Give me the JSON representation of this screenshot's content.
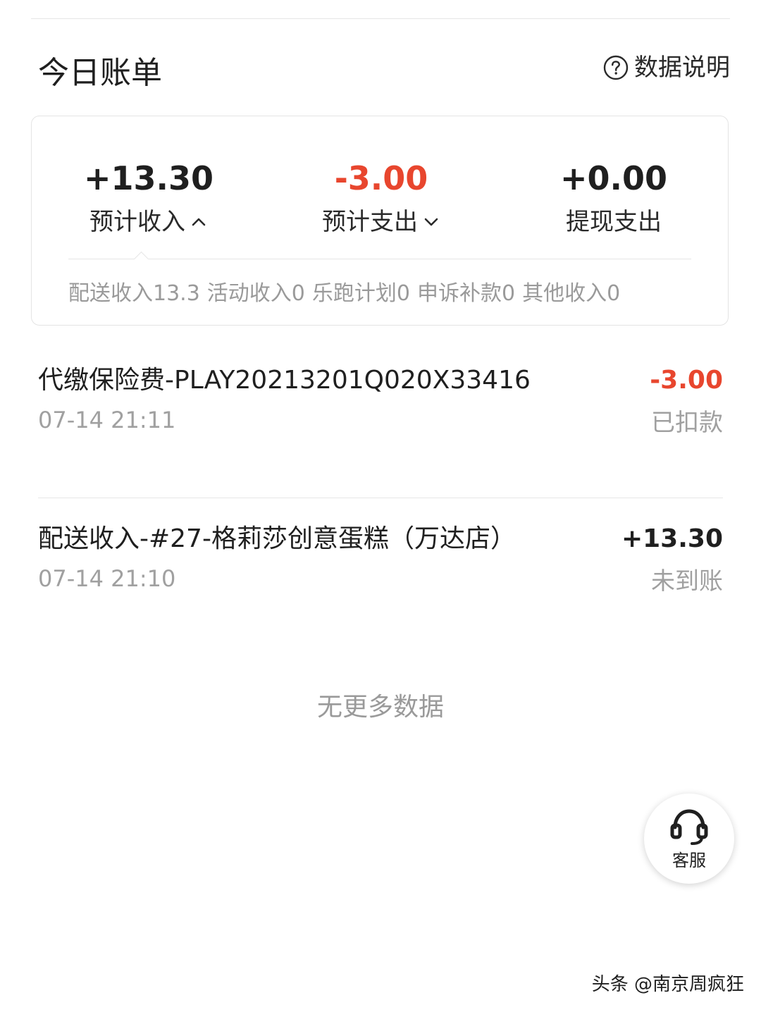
{
  "header": {
    "title": "今日账单",
    "help_label": "数据说明",
    "help_icon": "question-circle-icon"
  },
  "summary": {
    "income": {
      "value": "+13.30",
      "label": "预计收入",
      "chevron": "chevron-up-icon"
    },
    "expense": {
      "value": "-3.00",
      "label": "预计支出",
      "chevron": "chevron-down-icon"
    },
    "withdraw": {
      "value": "+0.00",
      "label": "提现支出"
    },
    "breakdown": [
      "配送收入13.3",
      "活动收入0",
      "乐跑计划0",
      "申诉补款0",
      "其他收入0"
    ]
  },
  "transactions": [
    {
      "description": "代缴保险费-PLAY20213201Q020X33416",
      "time": "07-14 21:11",
      "amount": "-3.00",
      "status": "已扣款"
    },
    {
      "description": "配送收入-#27-格莉莎创意蛋糕（万达店）",
      "time": "07-14 21:10",
      "amount": "+13.30",
      "status": "未到账"
    }
  ],
  "empty_note": "无更多数据",
  "service": {
    "label": "客服",
    "icon": "headset-icon"
  },
  "watermark": "头条 @南京周疯狂",
  "colors": {
    "accent_red": "#e8462e",
    "text": "#1f1f1f",
    "muted": "#9a9a9a",
    "divider": "#e6e6e6"
  }
}
